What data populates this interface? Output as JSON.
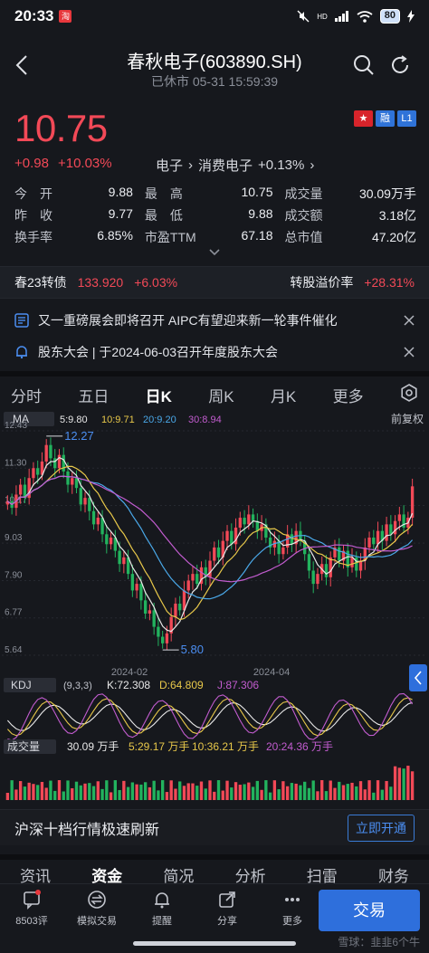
{
  "status_bar": {
    "time": "20:33",
    "notif_badge": "淘",
    "hd": "HD",
    "battery": "80"
  },
  "header": {
    "title": "春秋电子(603890.SH)",
    "subtitle": "已休市 05-31 15:59:39"
  },
  "quote": {
    "price": "10.75",
    "change": "+0.98",
    "change_pct": "+10.03%",
    "sector": "电子",
    "subsector": "消费电子",
    "subsector_pct": "+0.13%",
    "flags": [
      {
        "label": "★",
        "color": "#d8242b"
      },
      {
        "label": "融",
        "color": "#2f73d8"
      },
      {
        "label": "L1",
        "color": "#2f73d8"
      }
    ]
  },
  "stats": [
    [
      {
        "label": "今　开",
        "value": "9.88"
      },
      {
        "label": "最　高",
        "value": "10.75"
      },
      {
        "label": "成交量",
        "value": "30.09万手"
      }
    ],
    [
      {
        "label": "昨　收",
        "value": "9.77"
      },
      {
        "label": "最　低",
        "value": "9.88"
      },
      {
        "label": "成交额",
        "value": "3.18亿"
      }
    ],
    [
      {
        "label": "换手率",
        "value": "6.85%"
      },
      {
        "label": "市盈TTM",
        "value": "67.18"
      },
      {
        "label": "总市值",
        "value": "47.20亿"
      }
    ]
  ],
  "bond": {
    "name": "春23转债",
    "price": "133.920",
    "pct": "+6.03%",
    "premium_label": "转股溢价率",
    "premium_value": "+28.31%"
  },
  "notices": [
    {
      "text": "又一重磅展会即将召开 AIPC有望迎来新一轮事件催化"
    },
    {
      "text": "股东大会 | 于2024-06-03召开年度股东大会"
    }
  ],
  "period_tabs": [
    {
      "label": "分时",
      "active": false
    },
    {
      "label": "五日",
      "active": false
    },
    {
      "label": "日K",
      "active": true
    },
    {
      "label": "周K",
      "active": false
    },
    {
      "label": "月K",
      "active": false
    },
    {
      "label": "更多",
      "active": false
    }
  ],
  "chart_labels": {
    "ma_title": "MA",
    "ma5": "5:9.80",
    "ma10": "10:9.71",
    "ma20": "20:9.20",
    "ma30": "30:8.94",
    "adjust": "前复权",
    "kdj_title": "KDJ",
    "kdj_params": "(9,3,3)",
    "k": "K:72.308",
    "d": "D:64.809",
    "j": "J:87.306",
    "vol_title": "成交量",
    "vol": "30.09 万手",
    "vol5": "5:29.17 万手",
    "vol10": "10:36.21 万手",
    "vol20": "20:24.36 万手"
  },
  "chart_data": {
    "type": "candlestick",
    "y_ticks": [
      "12.43",
      "11.30",
      "10.17",
      "9.03",
      "7.90",
      "6.77",
      "5.64"
    ],
    "x_ticks": [
      "2024-02",
      "2024-04"
    ],
    "annotations": {
      "high": "12.27",
      "low": "5.80"
    },
    "ylim": [
      5.64,
      12.43
    ],
    "closes": [
      10.3,
      10.1,
      10.5,
      10.8,
      10.4,
      11.0,
      11.3,
      11.1,
      11.5,
      12.0,
      11.6,
      11.3,
      11.7,
      11.2,
      10.8,
      11.0,
      10.7,
      10.2,
      10.4,
      10.0,
      9.6,
      9.8,
      9.3,
      9.0,
      9.2,
      8.8,
      8.4,
      8.6,
      8.1,
      7.6,
      7.8,
      7.3,
      6.9,
      7.0,
      6.5,
      6.2,
      6.0,
      6.3,
      6.8,
      7.2,
      7.0,
      7.6,
      7.9,
      8.1,
      7.8,
      8.3,
      8.0,
      8.5,
      8.9,
      8.6,
      9.1,
      9.4,
      9.0,
      9.5,
      9.8,
      9.6,
      9.9,
      9.7,
      9.4,
      9.6,
      9.2,
      8.9,
      9.1,
      8.7,
      8.9,
      9.3,
      9.0,
      9.4,
      9.1,
      8.7,
      8.2,
      7.8,
      8.1,
      8.4,
      8.0,
      8.6,
      8.9,
      8.5,
      8.8,
      8.3,
      8.6,
      8.2,
      8.5,
      8.9,
      9.2,
      9.0,
      9.4,
      9.1,
      9.6,
      9.3,
      9.7,
      9.9,
      9.5,
      9.8,
      10.75
    ],
    "ma_colors": {
      "ma5": "#e8e8e8",
      "ma10": "#e8c84a",
      "ma20": "#4aa8e8",
      "ma30": "#c25ccf"
    }
  },
  "promo": {
    "text": "沪深十档行情极速刷新",
    "button": "立即开通"
  },
  "info_tabs": [
    {
      "label": "资讯",
      "active": false
    },
    {
      "label": "资金",
      "active": true
    },
    {
      "label": "简况",
      "active": false
    },
    {
      "label": "分析",
      "active": false
    },
    {
      "label": "扫雷",
      "active": false
    },
    {
      "label": "财务",
      "active": false
    }
  ],
  "toolbar": [
    {
      "label": "8503评",
      "icon": "comment-icon"
    },
    {
      "label": "模拟交易",
      "icon": "swap-icon"
    },
    {
      "label": "提醒",
      "icon": "bell-icon"
    },
    {
      "label": "分享",
      "icon": "share-icon"
    },
    {
      "label": "更多",
      "icon": "more-icon"
    }
  ],
  "trade_button": "交易",
  "watermark": "雪球：韭韭6个牛"
}
